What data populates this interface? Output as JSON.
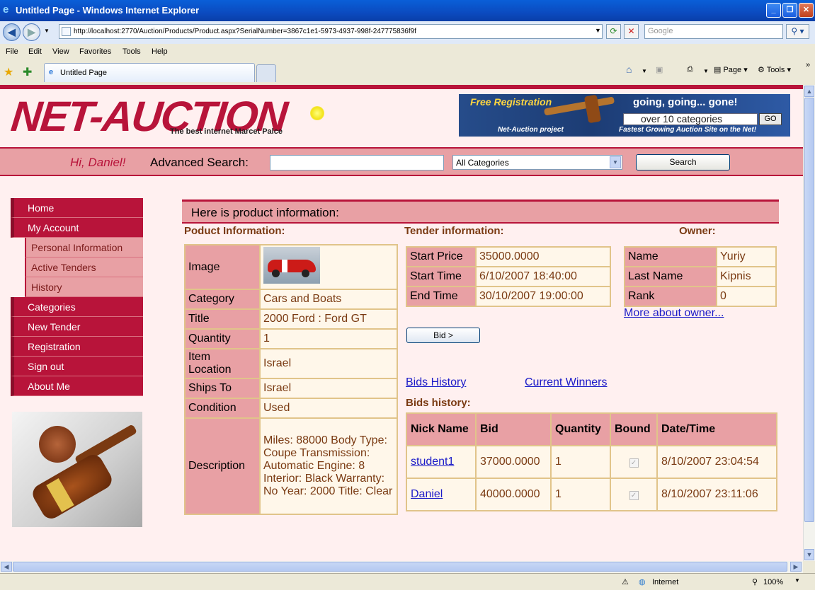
{
  "window": {
    "title": "Untitled Page - Windows Internet Explorer",
    "min": "_",
    "max": "❐",
    "close": "✕"
  },
  "address": {
    "url": "http://localhost:2770/Auction/Products/Product.aspx?SerialNumber=3867c1e1-5973-4937-998f-247775836f9f",
    "search_placeholder": "Google"
  },
  "menu_bar": [
    "File",
    "Edit",
    "View",
    "Favorites",
    "Tools",
    "Help"
  ],
  "tab": {
    "label": "Untitled Page"
  },
  "command_bar": {
    "page": "Page",
    "tools": "Tools"
  },
  "status_bar": {
    "zone": "Internet",
    "zoom": "100%"
  },
  "site": {
    "logo": "NET-AUCTION",
    "tagline": "The best internet Marcet Palce",
    "banner": {
      "free": "Free Registration",
      "going": "going, going... gone!",
      "categories": "over 10 categories",
      "go": "GO",
      "project": "Net-Auction project",
      "fastest": "Fastest Growing Auction Site on the Net!"
    },
    "greeting": "Hi, Daniel!",
    "advanced_search": "Advanced Search:",
    "category_select": "All Categories",
    "search_button": "Search"
  },
  "nav": {
    "home": "Home",
    "my_account": "My Account",
    "personal": "Personal Information",
    "active_tenders": "Active Tenders",
    "history": "History",
    "categories": "Categories",
    "new_tender": "New Tender",
    "registration": "Registration",
    "sign_out": "Sign out",
    "about": "About Me"
  },
  "content": {
    "header": "Here is product information:",
    "product_section": "Poduct Information:",
    "tender_section": "Tender information:",
    "owner_section": "Owner:",
    "product": {
      "image_label": "Image",
      "rows": [
        {
          "label": "Category",
          "value": "Cars and Boats"
        },
        {
          "label": "Title",
          "value": "2000 Ford : Ford GT"
        },
        {
          "label": "Quantity",
          "value": "1"
        },
        {
          "label": "Item Location",
          "value": "Israel"
        },
        {
          "label": "Ships To",
          "value": "Israel"
        },
        {
          "label": "Condition",
          "value": "Used"
        },
        {
          "label": "Description",
          "value": "Miles: 88000 Body Type: Coupe Transmission: Automatic Engine: 8 Interior: Black Warranty: No Year: 2000 Title: Clear"
        }
      ]
    },
    "tender": [
      {
        "label": "Start Price",
        "value": "35000.0000"
      },
      {
        "label": "Start Time",
        "value": "6/10/2007 18:40:00"
      },
      {
        "label": "End Time",
        "value": "30/10/2007 19:00:00"
      }
    ],
    "owner": [
      {
        "label": "Name",
        "value": "Yuriy"
      },
      {
        "label": "Last Name",
        "value": "Kipnis"
      },
      {
        "label": "Rank",
        "value": "0"
      }
    ],
    "more_owner": "More about owner...",
    "bid_button": "Bid >",
    "bids_history_link": "Bids History",
    "current_winners_link": "Current Winners",
    "bids_history_title": "Bids history:",
    "bids": {
      "headers": [
        "Nick Name",
        "Bid",
        "Quantity",
        "Bound",
        "Date/Time"
      ],
      "rows": [
        {
          "nick": "student1",
          "bid": "37000.0000",
          "qty": "1",
          "bound": true,
          "date": "8/10/2007 23:04:54"
        },
        {
          "nick": "Daniel",
          "bid": "40000.0000",
          "qty": "1",
          "bound": true,
          "date": "8/10/2007 23:11:06"
        }
      ]
    }
  }
}
